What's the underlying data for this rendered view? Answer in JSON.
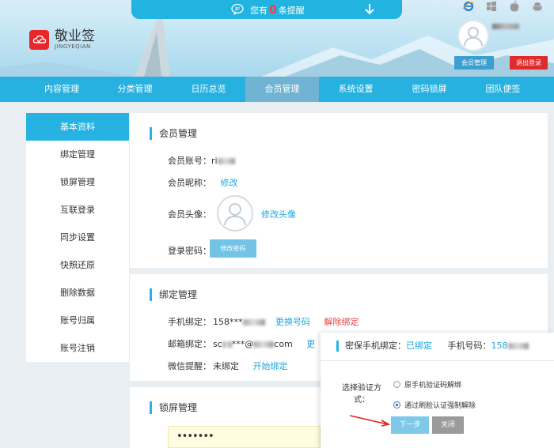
{
  "notice": {
    "prefix": "您有",
    "count": "0",
    "suffix": "条提醒"
  },
  "logo": {
    "cn": "敬业签",
    "en": "JINGYEQIAN"
  },
  "os_icons": [
    "ie-icon",
    "windows-icon",
    "apple-icon",
    "android-icon"
  ],
  "user_buttons": {
    "member": "会员管理",
    "logout": "退出登录"
  },
  "nav": [
    "内容管理",
    "分类管理",
    "日历总览",
    "会员管理",
    "系统设置",
    "密码锁屏",
    "团队便签"
  ],
  "sidebar": [
    "基本资料",
    "绑定管理",
    "锁屏管理",
    "互联登录",
    "同步设置",
    "快照还原",
    "删除数据",
    "账号归属",
    "账号注销"
  ],
  "member": {
    "title": "会员管理",
    "account_label": "会员账号：",
    "account_value": "ri",
    "nickname_label": "会员昵称：",
    "nickname_link": "修改",
    "avatar_label": "会员头像：",
    "avatar_link": "修改头像",
    "password_label": "登录密码：",
    "password_button": "修改密码"
  },
  "binding": {
    "title": "绑定管理",
    "phone_label": "手机绑定：",
    "phone_value": "158***",
    "phone_change": "更换号码",
    "phone_unbind": "解除绑定",
    "email_label": "邮箱绑定：",
    "email_value_a": "sc",
    "email_value_b": "***@",
    "email_value_c": "com",
    "email_link": "更",
    "wechat_label": "微信提醒：",
    "wechat_value": "未绑定",
    "wechat_link": "开始绑定"
  },
  "lock": {
    "title": "锁屏管理",
    "password_mask": "•••••••"
  },
  "popup": {
    "secure_label": "密保手机绑定：",
    "secure_value": "已绑定",
    "phone_label": "手机号码：",
    "phone_value": "158",
    "choose_label": "选择验证方式：",
    "option1": "原手机验证码解绑",
    "option2": "通过刷脸认证强制解除",
    "selected": 2,
    "next_button": "下一步",
    "close_button": "关闭"
  },
  "colors": {
    "accent": "#26b3e2",
    "red": "#e02b2b",
    "link": "#1ea7dc"
  }
}
